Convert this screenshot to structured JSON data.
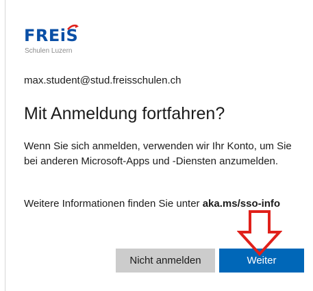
{
  "logo": {
    "word": "FREiS",
    "subtitle": "Schulen Luzern"
  },
  "account": {
    "email": "max.student@stud.freisschulen.ch"
  },
  "dialog": {
    "title": "Mit Anmeldung fortfahren?",
    "description": "Wenn Sie sich anmelden, verwenden wir Ihr Konto, um Sie bei anderen Microsoft-Apps und -Diensten anzumelden.",
    "info_prefix": "Weitere Informationen finden Sie unter ",
    "info_link": "aka.ms/sso-info"
  },
  "buttons": {
    "decline": "Nicht anmelden",
    "continue": "Weiter"
  },
  "colors": {
    "brand": "#0a4fa6",
    "primary_button": "#0067b8",
    "secondary_button": "#cccccc",
    "annotation_arrow": "#e0201a"
  }
}
